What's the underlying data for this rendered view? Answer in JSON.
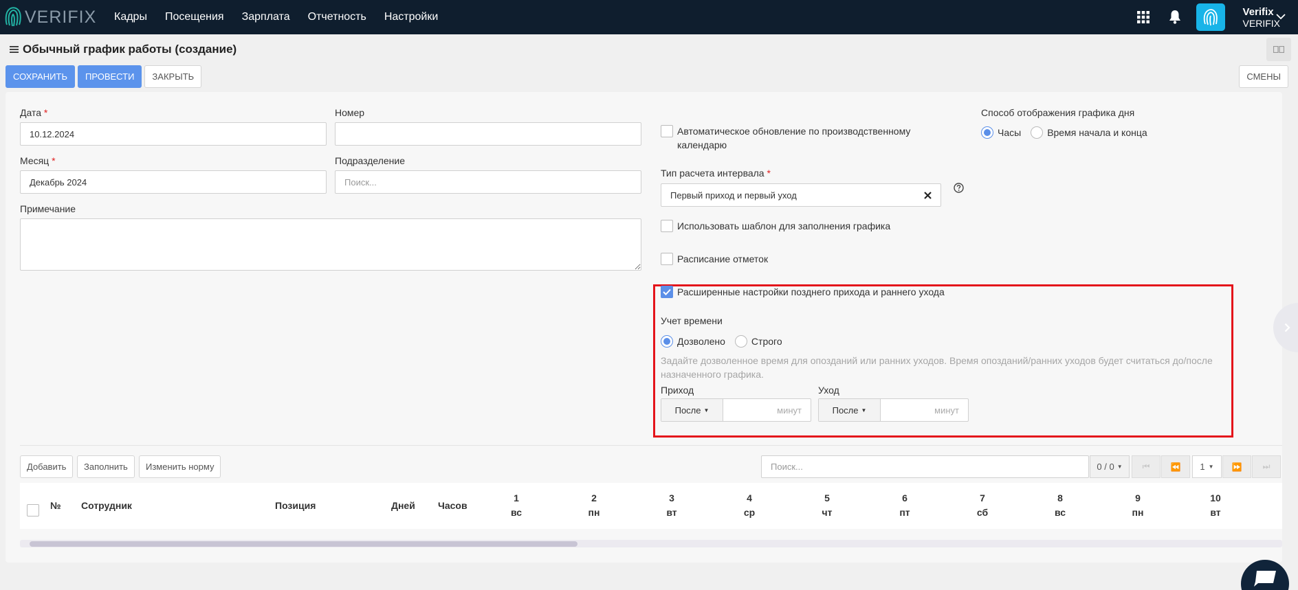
{
  "brand": {
    "logo_text": "VERIFIX"
  },
  "nav": [
    "Кадры",
    "Посещения",
    "Зарплата",
    "Отчетность",
    "Настройки"
  ],
  "user": {
    "name": "Verifix",
    "org": "VERIFIX"
  },
  "page": {
    "title": "Обычный график работы (создание)"
  },
  "actions": {
    "save": "СОХРАНИТЬ",
    "post": "ПРОВЕСТИ",
    "close": "ЗАКРЫТЬ",
    "shifts": "СМЕНЫ"
  },
  "form": {
    "date_label": "Дата",
    "date_value": "10.12.2024",
    "number_label": "Номер",
    "number_value": "",
    "month_label": "Месяц",
    "month_value": "Декабрь 2024",
    "division_label": "Подразделение",
    "division_placeholder": "Поиск...",
    "note_label": "Примечание",
    "required_mark": "*",
    "auto_update_label_1": "Автоматическое обновление по производственному",
    "auto_update_label_2": "календарю",
    "display_mode_label": "Способ отображения графика дня",
    "display_mode_hours": "Часы",
    "display_mode_startend": "Время начала и конца",
    "interval_type_label": "Тип расчета интервала",
    "interval_type_value": "Первый приход и первый уход",
    "use_template_label": "Использовать шаблон для заполнения графика",
    "marks_schedule_label": "Расписание отметок",
    "advanced_label": "Расширенные настройки позднего прихода и раннего ухода",
    "time_accounting_label": "Учет времени",
    "time_allowed": "Дозволено",
    "time_strict": "Строго",
    "hint_1": "Задайте дозволенное время для опозданий или ранних уходов. Время опозданий/ранних уходов будет считаться до/после",
    "hint_2": "назначенного графика.",
    "arrival_label": "Приход",
    "leave_label": "Уход",
    "after_option": "После",
    "minutes_placeholder": "минут"
  },
  "table": {
    "add": "Добавить",
    "fill": "Заполнить",
    "change_norm": "Изменить норму",
    "search_placeholder": "Поиск...",
    "count": "0 / 0",
    "page": "1",
    "col_num": "№",
    "col_employee": "Сотрудник",
    "col_position": "Позиция",
    "col_days": "Дней",
    "col_hours": "Часов",
    "days": [
      {
        "num": "1",
        "wd": "вс"
      },
      {
        "num": "2",
        "wd": "пн"
      },
      {
        "num": "3",
        "wd": "вт"
      },
      {
        "num": "4",
        "wd": "ср"
      },
      {
        "num": "5",
        "wd": "чт"
      },
      {
        "num": "6",
        "wd": "пт"
      },
      {
        "num": "7",
        "wd": "сб"
      },
      {
        "num": "8",
        "wd": "вс"
      },
      {
        "num": "9",
        "wd": "пн"
      },
      {
        "num": "10",
        "wd": "вт"
      }
    ]
  },
  "colors": {
    "topbar": "#0f1e2e",
    "accent": "#5b93ec",
    "highlight": "#e4141b",
    "fingerprint": "#18b4e8"
  }
}
